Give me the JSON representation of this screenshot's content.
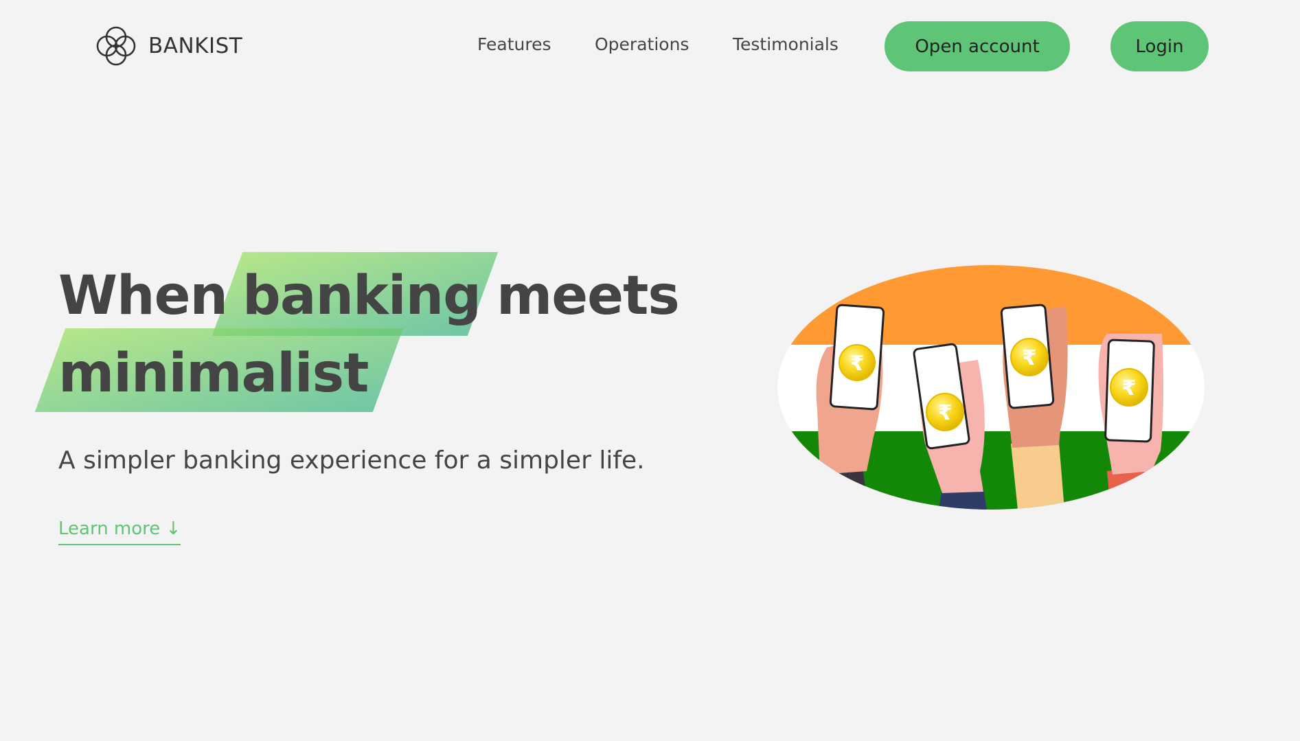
{
  "nav": {
    "logo_text": "BANKIST",
    "links": [
      "Features",
      "Operations",
      "Testimonials"
    ],
    "open_account_label": "Open account",
    "login_label": "Login"
  },
  "hero": {
    "title_word_1": "When",
    "title_word_2": "banking",
    "title_word_3": "meets",
    "title_word_4": "minimalist",
    "subtitle": "A simpler banking experience for a simpler life.",
    "learn_more": "Learn more ↓",
    "coin_symbol": "₹"
  },
  "colors": {
    "background": "#f3f3f3",
    "accent": "#5ec576",
    "text": "#444444",
    "flag_saffron": "#ff9933",
    "flag_green": "#138808"
  }
}
